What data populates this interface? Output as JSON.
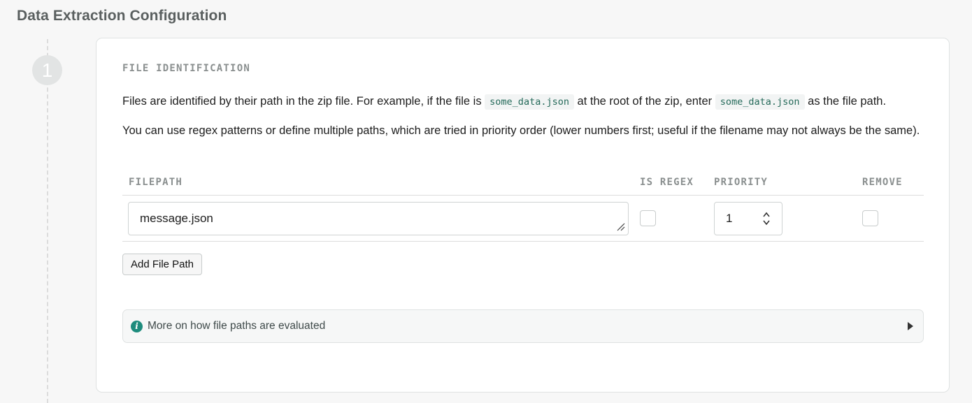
{
  "page": {
    "title": "Data Extraction Configuration"
  },
  "step": {
    "number": "1"
  },
  "section": {
    "title": "FILE IDENTIFICATION",
    "paragraph1": {
      "part1": "Files are identified by their path in the zip file. For example, if the file is ",
      "code1": "some_data.json",
      "part2": " at the root of the zip, enter ",
      "code2": "some_data.json",
      "part3": " as the file path."
    },
    "paragraph2": "You can use regex patterns or define multiple paths, which are tried in priority order (lower numbers first; useful if the filename may not always be the same)."
  },
  "table": {
    "headers": {
      "filepath": "FILEPATH",
      "is_regex": "IS REGEX",
      "priority": "PRIORITY",
      "remove": "REMOVE"
    },
    "rows": [
      {
        "filepath": "message.json",
        "is_regex": false,
        "priority": "1",
        "remove": false
      }
    ]
  },
  "buttons": {
    "add_file_path": "Add File Path"
  },
  "details": {
    "label": "More on how file paths are evaluated",
    "icon": "info-icon",
    "toggle_icon": "caret-right-icon"
  },
  "colors": {
    "accent": "#1e8c7d",
    "code_text": "#256a5a"
  }
}
